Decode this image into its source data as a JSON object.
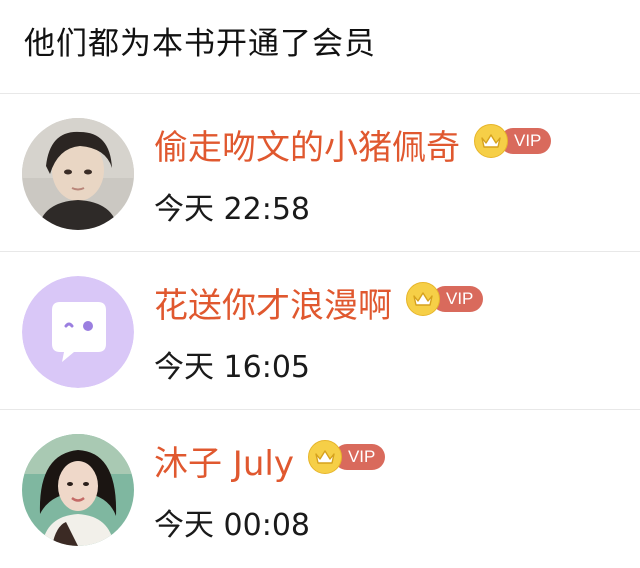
{
  "header": {
    "title": "他们都为本书开通了会员"
  },
  "members": [
    {
      "name": "偷走吻文的小猪佩奇",
      "badge": "VIP",
      "time": "今天 22:58",
      "avatar": "portrait-avatar"
    },
    {
      "name": "花送你才浪漫啊",
      "badge": "VIP",
      "time": "今天 16:05",
      "avatar": "chat-bubble-avatar"
    },
    {
      "name": "沐子 July",
      "badge": "VIP",
      "time": "今天 00:08",
      "avatar": "portrait-avatar"
    }
  ],
  "colors": {
    "name": "#e0582f",
    "vip_tag": "#d96a5c",
    "vip_crown": "#f6cf47",
    "default_avatar_bg": "#d9c7f7"
  }
}
